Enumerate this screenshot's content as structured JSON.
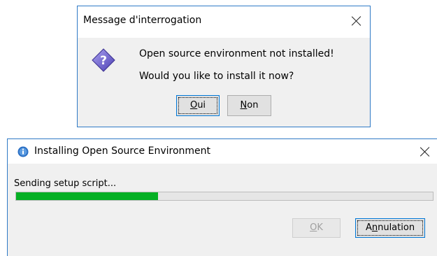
{
  "question_dialog": {
    "title": "Message d'interrogation",
    "message_line1": "Open source environment not installed!",
    "message_line2": "Would you like to install it now?",
    "yes_button": {
      "mnemonic": "O",
      "rest": "ui"
    },
    "no_button": {
      "mnemonic": "N",
      "rest": "on"
    },
    "icon": "question-icon"
  },
  "install_dialog": {
    "title": "Installing Open Source Environment",
    "status": "Sending setup script...",
    "progress_fraction": 0.34,
    "progress_color": "#06b025",
    "ok_button": {
      "mnemonic": "O",
      "rest": "K"
    },
    "cancel_button": {
      "prefix": "A",
      "mnemonic": "n",
      "rest": "nulation"
    },
    "icon": "app-info-icon"
  },
  "colors": {
    "accent_border": "#2f7ac6",
    "dialog_bg": "#f0f0f0"
  }
}
